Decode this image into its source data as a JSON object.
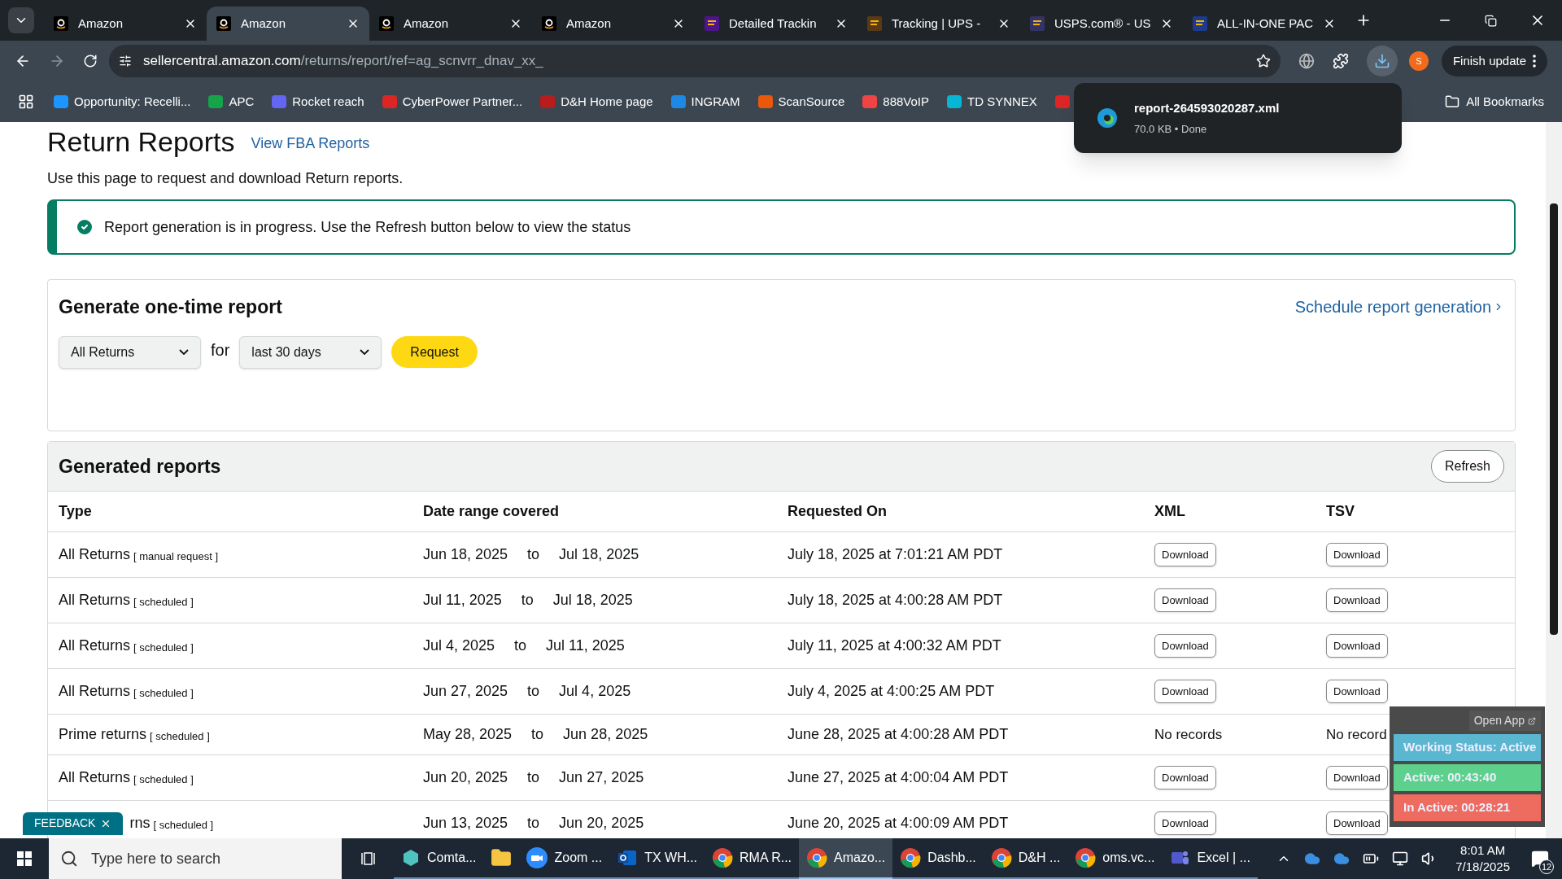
{
  "browser": {
    "tabs": [
      {
        "kind": "amazon",
        "title": "Amazon",
        "selected": false
      },
      {
        "kind": "amazon",
        "title": "Amazon",
        "selected": true
      },
      {
        "kind": "amazon",
        "title": "Amazon",
        "selected": false
      },
      {
        "kind": "amazon",
        "title": "Amazon",
        "selected": false
      },
      {
        "kind": "fedex",
        "title": "Detailed Trackin",
        "selected": false
      },
      {
        "kind": "ups",
        "title": "Tracking | UPS -",
        "selected": false
      },
      {
        "kind": "usps",
        "title": "USPS.com® - US",
        "selected": false
      },
      {
        "kind": "seventeen",
        "title": "ALL-IN-ONE PAC",
        "selected": false
      }
    ],
    "url_host": "sellercentral.amazon.com",
    "url_path": "/returns/report/ref=ag_scnvrr_dnav_xx_",
    "profile_initial": "S",
    "update_button": "Finish update",
    "bookmarks": [
      {
        "kind": "cloud",
        "label": "Opportunity: Recelli..."
      },
      {
        "kind": "apc",
        "label": "APC"
      },
      {
        "kind": "rocket",
        "label": "Rocket reach"
      },
      {
        "kind": "cp",
        "label": "CyberPower Partner..."
      },
      {
        "kind": "dh",
        "label": "D&H Home page"
      },
      {
        "kind": "ingram",
        "label": "INGRAM"
      },
      {
        "kind": "scan",
        "label": "ScanSource"
      },
      {
        "kind": "voip",
        "label": "888VoIP"
      },
      {
        "kind": "td",
        "label": "TD SYNNEX"
      },
      {
        "kind": "l"
      }
    ],
    "all_bookmarks": "All Bookmarks",
    "download_popup": {
      "file": "report-264593020287.xml",
      "detail": "70.0 KB • Done"
    }
  },
  "page": {
    "title": "Return Reports",
    "fba_link": "View FBA Reports",
    "intro": "Use this page to request and download Return reports.",
    "alert": "Report generation is in progress. Use the Refresh button below to view the status",
    "generate": {
      "title": "Generate one-time report",
      "schedule_link": "Schedule report generation",
      "report_type": "All Returns",
      "for_label": "for",
      "period": "last 30 days",
      "request_button": "Request"
    },
    "generated": {
      "title": "Generated reports",
      "refresh_button": "Refresh",
      "columns": [
        "Type",
        "Date range covered",
        "Requested On",
        "XML",
        "TSV"
      ],
      "rows": [
        {
          "type": "All Returns",
          "note": "[ manual request ]",
          "from": "Jun 18, 2025",
          "sep": "to",
          "to": "Jul 18, 2025",
          "requested": "July 18, 2025 at 7:01:21 AM PDT",
          "xml": {
            "kind": "button",
            "label": "Download"
          },
          "tsv": {
            "kind": "button",
            "label": "Download"
          }
        },
        {
          "type": "All Returns",
          "note": "[ scheduled ]",
          "from": "Jul 11, 2025",
          "sep": "to",
          "to": "Jul 18, 2025",
          "requested": "July 18, 2025 at 4:00:28 AM PDT",
          "xml": {
            "kind": "button",
            "label": "Download"
          },
          "tsv": {
            "kind": "button",
            "label": "Download"
          }
        },
        {
          "type": "All Returns",
          "note": "[ scheduled ]",
          "from": "Jul 4, 2025",
          "sep": "to",
          "to": "Jul 11, 2025",
          "requested": "July 11, 2025 at 4:00:32 AM PDT",
          "xml": {
            "kind": "button",
            "label": "Download"
          },
          "tsv": {
            "kind": "button",
            "label": "Download"
          }
        },
        {
          "type": "All Returns",
          "note": "[ scheduled ]",
          "from": "Jun 27, 2025",
          "sep": "to",
          "to": "Jul 4, 2025",
          "requested": "July 4, 2025 at 4:00:25 AM PDT",
          "xml": {
            "kind": "button",
            "label": "Download"
          },
          "tsv": {
            "kind": "button",
            "label": "Download"
          }
        },
        {
          "type": "Prime returns",
          "note": "[ scheduled ]",
          "from": "May 28, 2025",
          "sep": "to",
          "to": "Jun 28, 2025",
          "requested": "June 28, 2025 at 4:00:28 AM PDT",
          "xml": {
            "kind": "text",
            "label": "No records"
          },
          "tsv": {
            "kind": "text",
            "label": "No record"
          }
        },
        {
          "type": "All Returns",
          "note": "[ scheduled ]",
          "from": "Jun 20, 2025",
          "sep": "to",
          "to": "Jun 27, 2025",
          "requested": "June 27, 2025 at 4:00:04 AM PDT",
          "xml": {
            "kind": "button",
            "label": "Download"
          },
          "tsv": {
            "kind": "button",
            "label": "Download"
          }
        },
        {
          "type": "rns",
          "note": "[ scheduled ]",
          "from": "Jun 13, 2025",
          "sep": "to",
          "to": "Jun 20, 2025",
          "requested": "June 20, 2025 at 4:00:09 AM PDT",
          "xml": {
            "kind": "button",
            "label": "Download"
          },
          "tsv": {
            "kind": "button",
            "label": "Download"
          }
        }
      ]
    }
  },
  "feedback": "FEEDBACK",
  "tracker": {
    "open_app": "Open App",
    "status": "Working Status: Active",
    "active": "Active: 00:43:40",
    "inactive": "In Active: 00:28:21"
  },
  "taskbar": {
    "search_placeholder": "Type here to search",
    "apps": [
      {
        "kind": "cube",
        "label": "Comta...",
        "selected": false
      },
      {
        "kind": "folder",
        "selected": false
      },
      {
        "kind": "zoom",
        "label": "Zoom ...",
        "selected": false
      },
      {
        "kind": "outlook",
        "label": "TX WH...",
        "selected": false
      },
      {
        "kind": "chrome",
        "label": "RMA R...",
        "selected": false
      },
      {
        "kind": "chrome",
        "label": "Amazo...",
        "selected": true
      },
      {
        "kind": "chrome",
        "label": "Dashb...",
        "selected": false
      },
      {
        "kind": "chrome",
        "label": "D&H ...",
        "selected": false
      },
      {
        "kind": "chrome",
        "label": "oms.vc...",
        "selected": false
      },
      {
        "kind": "teams",
        "label": "Excel | ...",
        "selected": false
      }
    ],
    "time": "8:01 AM",
    "date": "7/18/2025",
    "notifications": "12"
  }
}
